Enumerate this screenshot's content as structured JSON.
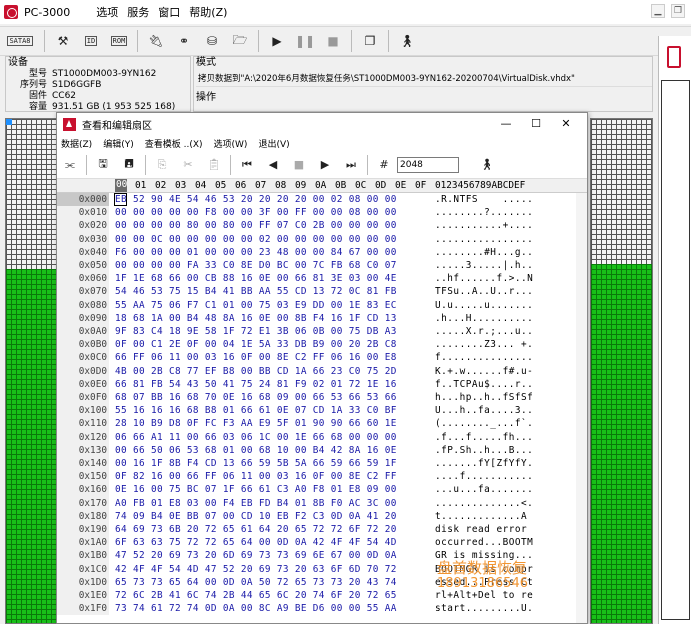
{
  "app": {
    "title": "PC-3000",
    "menu": [
      "选项",
      "服务",
      "窗口",
      "帮助(Z)"
    ]
  },
  "toolbar": {
    "sata_label": "SATA8",
    "buttons": [
      "tools-icon",
      "id-icon",
      "rom-icon",
      "plug-icon",
      "binoculars-icon",
      "disk-icon",
      "folder-icon",
      "play-icon",
      "pause-icon",
      "stop-icon",
      "copy-icon",
      "exit-icon"
    ]
  },
  "device": {
    "header": "设备",
    "rows": [
      {
        "label": "型号",
        "value": "ST1000DM003-9YN162"
      },
      {
        "label": "序列号",
        "value": "S1D6GGFB"
      },
      {
        "label": "固件",
        "value": "CC62"
      },
      {
        "label": "容量",
        "value": "931.51 GB (1 953 525 168)"
      }
    ]
  },
  "mode": {
    "header": "模式",
    "task": "拷贝数据到\"A:\\2020年6月数据恢复任务\\ST1000DM003-9YN162-20200704\\VirtualDisk.vhdx\"",
    "ops_label": "操作"
  },
  "dialog": {
    "title": "查看和编辑扇区",
    "menu": [
      "数据(Z)",
      "编辑(Y)",
      "查看模板 ..(X)",
      "选项(W)",
      "退出(V)"
    ],
    "sector_value": "2048",
    "controls": {
      "minimize": "—",
      "maximize": "☐",
      "close": "✕"
    }
  },
  "hex": {
    "columns": [
      "00",
      "01",
      "02",
      "03",
      "04",
      "05",
      "06",
      "07",
      "08",
      "09",
      "0A",
      "0B",
      "0C",
      "0D",
      "0E",
      "0F"
    ],
    "ascii_header": "0123456789ABCDEF",
    "rows": [
      {
        "off": "0x000",
        "hex": "EB 52 90 4E 54 46 53 20 20 20 20 00 02 08 00 00",
        "ascii": ".R.NTFS    ....."
      },
      {
        "off": "0x010",
        "hex": "00 00 00 00 00 F8 00 00 3F 00 FF 00 00 08 00 00",
        "ascii": "........?......."
      },
      {
        "off": "0x020",
        "hex": "00 00 00 00 80 00 80 00 FF 07 C0 2B 00 00 00 00",
        "ascii": "...........+...."
      },
      {
        "off": "0x030",
        "hex": "00 00 0C 00 00 00 00 00 02 00 00 00 00 00 00 00",
        "ascii": "................"
      },
      {
        "off": "0x040",
        "hex": "F6 00 00 00 01 00 00 00 23 48 00 00 84 67 00 00",
        "ascii": "........#H...g.."
      },
      {
        "off": "0x050",
        "hex": "00 00 00 00 FA 33 C0 8E D0 BC 00 7C FB 68 C0 07",
        "ascii": ".....3.....|.h.."
      },
      {
        "off": "0x060",
        "hex": "1F 1E 68 66 00 CB 88 16 0E 00 66 81 3E 03 00 4E",
        "ascii": "..hf......f.>..N"
      },
      {
        "off": "0x070",
        "hex": "54 46 53 75 15 B4 41 BB AA 55 CD 13 72 0C 81 FB",
        "ascii": "TFSu..A..U..r..."
      },
      {
        "off": "0x080",
        "hex": "55 AA 75 06 F7 C1 01 00 75 03 E9 DD 00 1E 83 EC",
        "ascii": "U.u.....u......."
      },
      {
        "off": "0x090",
        "hex": "18 68 1A 00 B4 48 8A 16 0E 00 8B F4 16 1F CD 13",
        "ascii": ".h...H.........."
      },
      {
        "off": "0x0A0",
        "hex": "9F 83 C4 18 9E 58 1F 72 E1 3B 06 0B 00 75 DB A3",
        "ascii": ".....X.r.;...u.."
      },
      {
        "off": "0x0B0",
        "hex": "0F 00 C1 2E 0F 00 04 1E 5A 33 DB B9 00 20 2B C8",
        "ascii": "........Z3... +."
      },
      {
        "off": "0x0C0",
        "hex": "66 FF 06 11 00 03 16 0F 00 8E C2 FF 06 16 00 E8",
        "ascii": "f..............."
      },
      {
        "off": "0x0D0",
        "hex": "4B 00 2B C8 77 EF B8 00 BB CD 1A 66 23 C0 75 2D",
        "ascii": "K.+.w......f#.u-"
      },
      {
        "off": "0x0E0",
        "hex": "66 81 FB 54 43 50 41 75 24 81 F9 02 01 72 1E 16",
        "ascii": "f..TCPAu$....r.."
      },
      {
        "off": "0x0F0",
        "hex": "68 07 BB 16 68 70 0E 16 68 09 00 66 53 66 53 66",
        "ascii": "h...hp..h..fSfSf"
      },
      {
        "off": "0x100",
        "hex": "55 16 16 16 68 B8 01 66 61 0E 07 CD 1A 33 C0 BF",
        "ascii": "U...h..fa....3.."
      },
      {
        "off": "0x110",
        "hex": "28 10 B9 D8 0F FC F3 AA E9 5F 01 90 90 66 60 1E",
        "ascii": "(........_...f`."
      },
      {
        "off": "0x120",
        "hex": "06 66 A1 11 00 66 03 06 1C 00 1E 66 68 00 00 00",
        "ascii": ".f...f.....fh..."
      },
      {
        "off": "0x130",
        "hex": "00 66 50 06 53 68 01 00 68 10 00 B4 42 8A 16 0E",
        "ascii": ".fP.Sh..h...B..."
      },
      {
        "off": "0x140",
        "hex": "00 16 1F 8B F4 CD 13 66 59 5B 5A 66 59 66 59 1F",
        "ascii": ".......fY[ZfYfY."
      },
      {
        "off": "0x150",
        "hex": "0F 82 16 00 66 FF 06 11 00 03 16 0F 00 8E C2 FF",
        "ascii": "....f..........."
      },
      {
        "off": "0x160",
        "hex": "0E 16 00 75 BC 07 1F 66 61 C3 A0 F8 01 E8 09 00",
        "ascii": "...u...fa......."
      },
      {
        "off": "0x170",
        "hex": "A0 FB 01 E8 03 00 F4 EB FD B4 01 8B F0 AC 3C 00",
        "ascii": "..............<."
      },
      {
        "off": "0x180",
        "hex": "74 09 B4 0E BB 07 00 CD 10 EB F2 C3 0D 0A 41 20",
        "ascii": "t.............A "
      },
      {
        "off": "0x190",
        "hex": "64 69 73 6B 20 72 65 61 64 20 65 72 72 6F 72 20",
        "ascii": "disk read error "
      },
      {
        "off": "0x1A0",
        "hex": "6F 63 63 75 72 72 65 64 00 0D 0A 42 4F 4F 54 4D",
        "ascii": "occurred...BOOTM"
      },
      {
        "off": "0x1B0",
        "hex": "47 52 20 69 73 20 6D 69 73 73 69 6E 67 00 0D 0A",
        "ascii": "GR is missing..."
      },
      {
        "off": "0x1C0",
        "hex": "42 4F 4F 54 4D 47 52 20 69 73 20 63 6F 6D 70 72",
        "ascii": "BOOTMGR is compr"
      },
      {
        "off": "0x1D0",
        "hex": "65 73 73 65 64 00 0D 0A 50 72 65 73 73 20 43 74",
        "ascii": "essed...Press Ct"
      },
      {
        "off": "0x1E0",
        "hex": "72 6C 2B 41 6C 74 2B 44 65 6C 20 74 6F 20 72 65",
        "ascii": "rl+Alt+Del to re"
      },
      {
        "off": "0x1F0",
        "hex": "73 74 61 72 74 0D 0A 00 8C A9 BE D6 00 00 55 AA",
        "ascii": "start.........U."
      }
    ]
  },
  "watermark": {
    "line1": "盘首数据恢复",
    "line2": "18913186546"
  }
}
